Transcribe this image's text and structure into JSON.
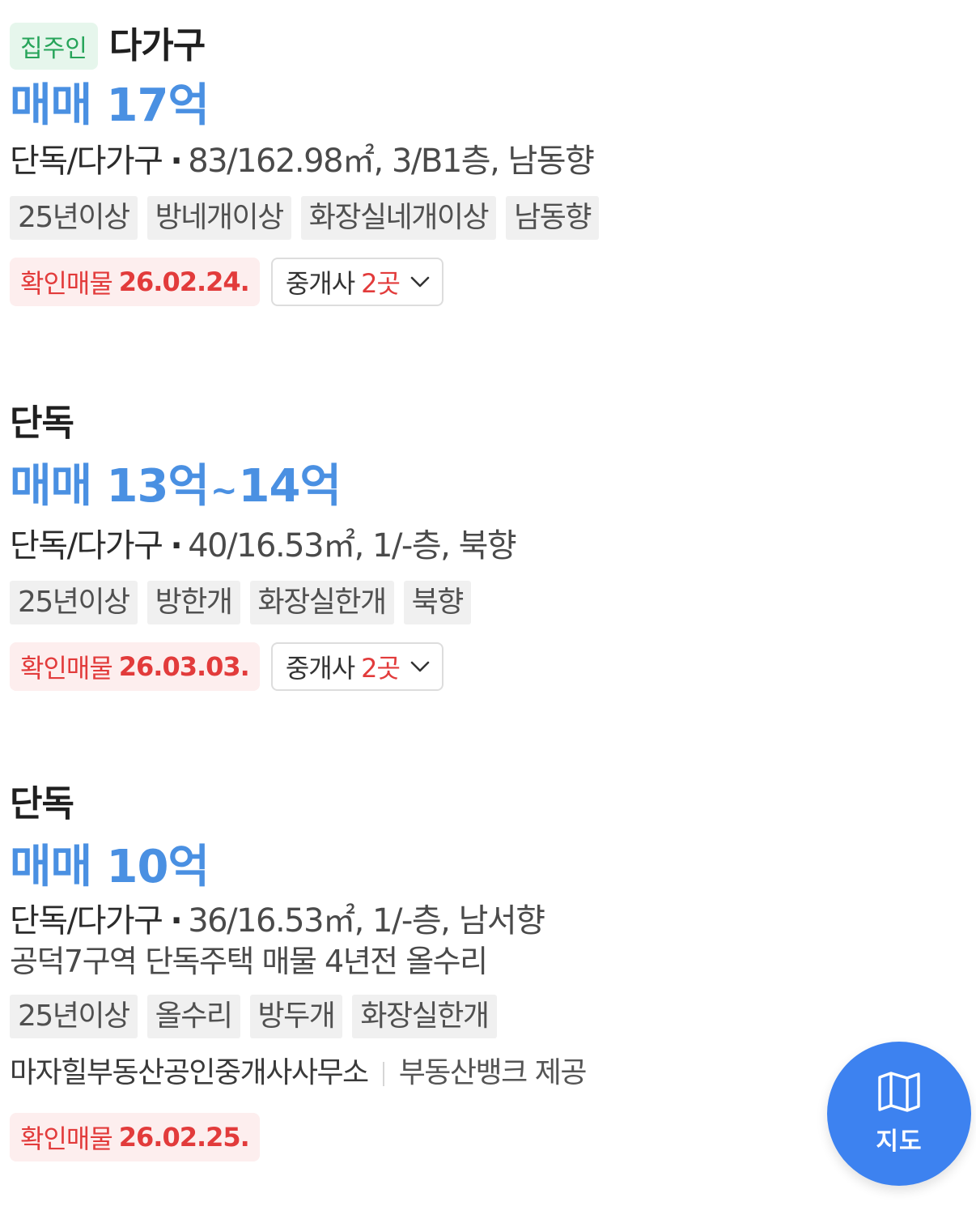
{
  "listings": [
    {
      "owner_badge": "집주인",
      "property_type": "다가구",
      "price_label": "매매",
      "price": "17억",
      "spec_type": "단독/다가구",
      "spec_separator": "·",
      "spec_detail": "83/162.98㎡, 3/B1층, 남동향",
      "tags": [
        "25년이상",
        "방네개이상",
        "화장실네개이상",
        "남동향"
      ],
      "verified_label": "확인매물",
      "verified_date": "26.02.24.",
      "agents_label": "중개사",
      "agents_count": "2곳"
    },
    {
      "property_type": "단독",
      "price_label": "매매",
      "price_min": "13억",
      "price_range_sep": "~",
      "price_max": "14억",
      "spec_type": "단독/다가구",
      "spec_separator": "·",
      "spec_detail": "40/16.53㎡, 1/-층, 북향",
      "tags": [
        "25년이상",
        "방한개",
        "화장실한개",
        "북향"
      ],
      "verified_label": "확인매물",
      "verified_date": "26.03.03.",
      "agents_label": "중개사",
      "agents_count": "2곳"
    },
    {
      "property_type": "단독",
      "price_label": "매매",
      "price": "10억",
      "spec_type": "단독/다가구",
      "spec_separator": "·",
      "spec_detail": "36/16.53㎡, 1/-층, 남서향",
      "description": "공덕7구역 단독주택 매물 4년전 올수리",
      "tags": [
        "25년이상",
        "올수리",
        "방두개",
        "화장실한개"
      ],
      "agency": "마자힐부동산공인중개사사무소",
      "supplier": "부동산뱅크 제공",
      "verified_label": "확인매물",
      "verified_date": "26.02.25."
    }
  ],
  "map_button": {
    "label": "지도",
    "icon": "map-icon",
    "color": "#3d82f0"
  },
  "colors": {
    "price": "#4a90e2",
    "owner_badge_text": "#27a45a",
    "owner_badge_bg": "#e6f6ec",
    "verified_text": "#e23b3b",
    "verified_bg": "#fdeeee",
    "tag_bg": "#f0f0f0"
  }
}
